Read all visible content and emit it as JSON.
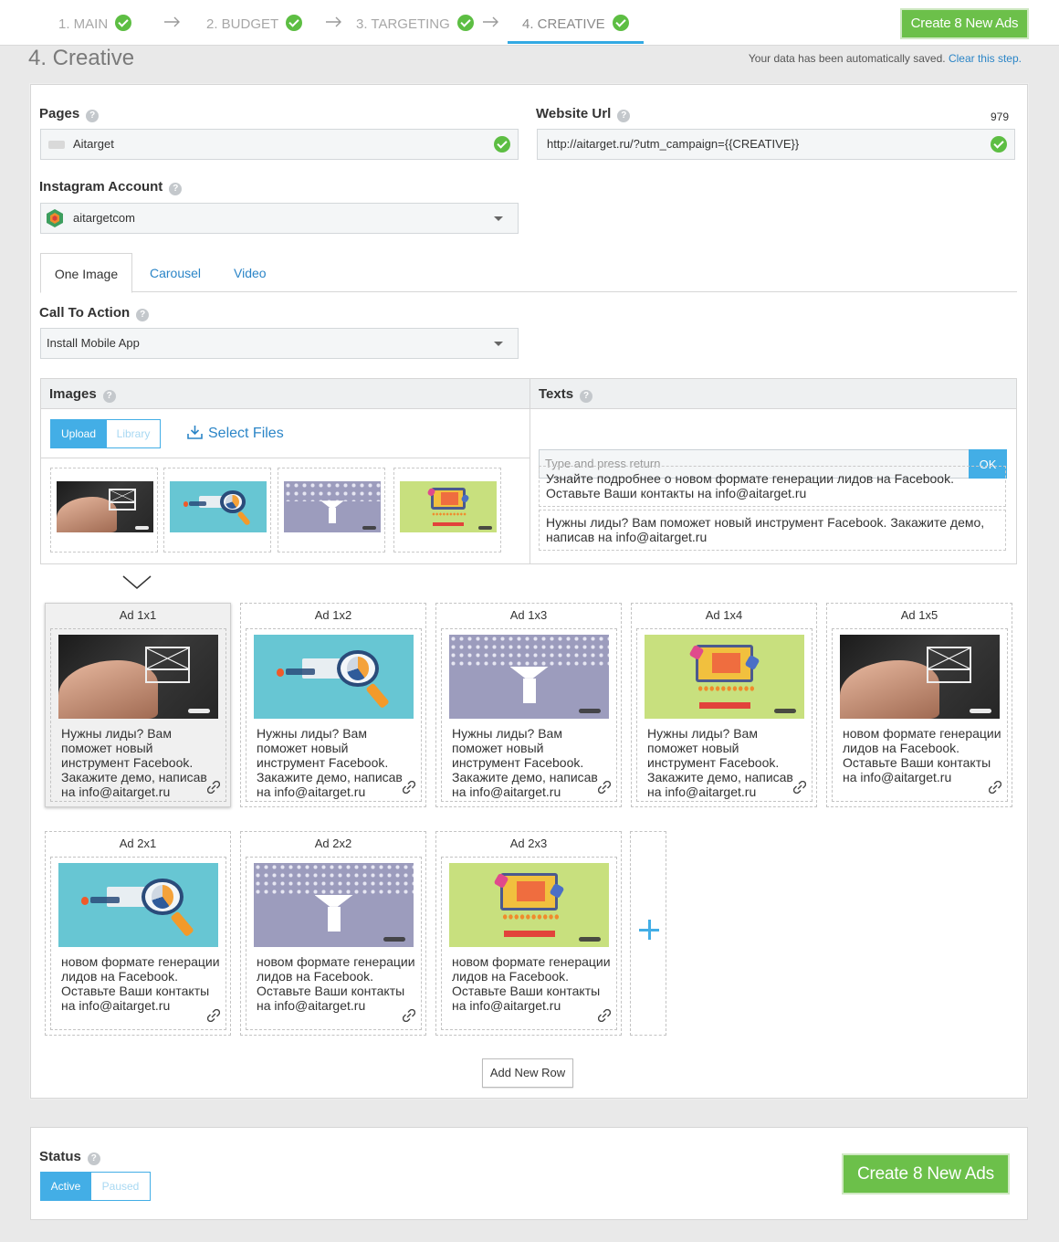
{
  "wizard": {
    "steps": [
      {
        "label": "1. MAIN"
      },
      {
        "label": "2. BUDGET"
      },
      {
        "label": "3. TARGETING"
      },
      {
        "label": "4. CREATIVE"
      }
    ],
    "active_step": "4. CREATIVE",
    "create_label": "Create 8 New Ads"
  },
  "header": {
    "title": "4. Creative",
    "saved_text": "Your data has been automatically saved.",
    "clear_link": "Clear this step."
  },
  "form": {
    "pages_label": "Pages",
    "pages_value": "Aitarget",
    "website_label": "Website Url",
    "website_value": "http://aitarget.ru/?utm_campaign={{CREATIVE}}",
    "website_count": "979",
    "instagram_label": "Instagram Account",
    "instagram_value": "aitargetcom",
    "cta_label": "Call To Action",
    "cta_value": "Install Mobile App"
  },
  "tabs": [
    "One Image",
    "Carousel",
    "Video"
  ],
  "images": {
    "title": "Images",
    "upload_label": "Upload",
    "library_label": "Library",
    "select_files_label": "Select Files",
    "thumbs": [
      "hand-envelope-image",
      "magnifier-chart-image",
      "funnel-image",
      "ab-testing-image"
    ]
  },
  "texts": {
    "title": "Texts",
    "input_placeholder": "Type and press return",
    "ok_label": "OK",
    "items": [
      "Узнайте подробнее о новом формате генерации лидов на Facebook. Оставьте Ваши контакты на info@aitarget.ru",
      "Нужны лиды? Вам поможет новый инструмент Facebook. Закажите демо, написав на info@aitarget.ru"
    ]
  },
  "ads": [
    {
      "title": "Ad 1x1",
      "image": "hand-envelope-image",
      "text": "Нужны лиды? Вам поможет новый инструмент Facebook. Закажите демо, написав на info@aitarget.ru"
    },
    {
      "title": "Ad 1x2",
      "image": "magnifier-chart-image",
      "text": "Нужны лиды? Вам поможет новый инструмент Facebook. Закажите демо, написав на info@aitarget.ru"
    },
    {
      "title": "Ad 1x3",
      "image": "funnel-image",
      "text": "Нужны лиды? Вам поможет новый инструмент Facebook. Закажите демо, написав на info@aitarget.ru"
    },
    {
      "title": "Ad 1x4",
      "image": "ab-testing-image",
      "text": "Нужны лиды? Вам поможет новый инструмент Facebook. Закажите демо, написав на info@aitarget.ru"
    },
    {
      "title": "Ad 1x5",
      "image": "hand-envelope-image",
      "text": "новом формате генерации лидов на Facebook. Оставьте Ваши контакты на info@aitarget.ru"
    },
    {
      "title": "Ad 2x1",
      "image": "magnifier-chart-image",
      "text": "новом формате генерации лидов на Facebook. Оставьте Ваши контакты на info@aitarget.ru"
    },
    {
      "title": "Ad 2x2",
      "image": "funnel-image",
      "text": "новом формате генерации лидов на Facebook. Оставьте Ваши контакты на info@aitarget.ru"
    },
    {
      "title": "Ad 2x3",
      "image": "ab-testing-image",
      "text": "новом формате генерации лидов на Facebook. Оставьте Ваши контакты на info@aitarget.ru"
    }
  ],
  "add_row_label": "Add New Row",
  "status": {
    "label": "Status",
    "active_label": "Active",
    "paused_label": "Paused",
    "create_label": "Create 8 New Ads"
  },
  "colors": {
    "accent": "#43aee6",
    "create_green": "#6cc04a",
    "check_green": "#5dbe43",
    "link_blue": "#2b85c7"
  }
}
